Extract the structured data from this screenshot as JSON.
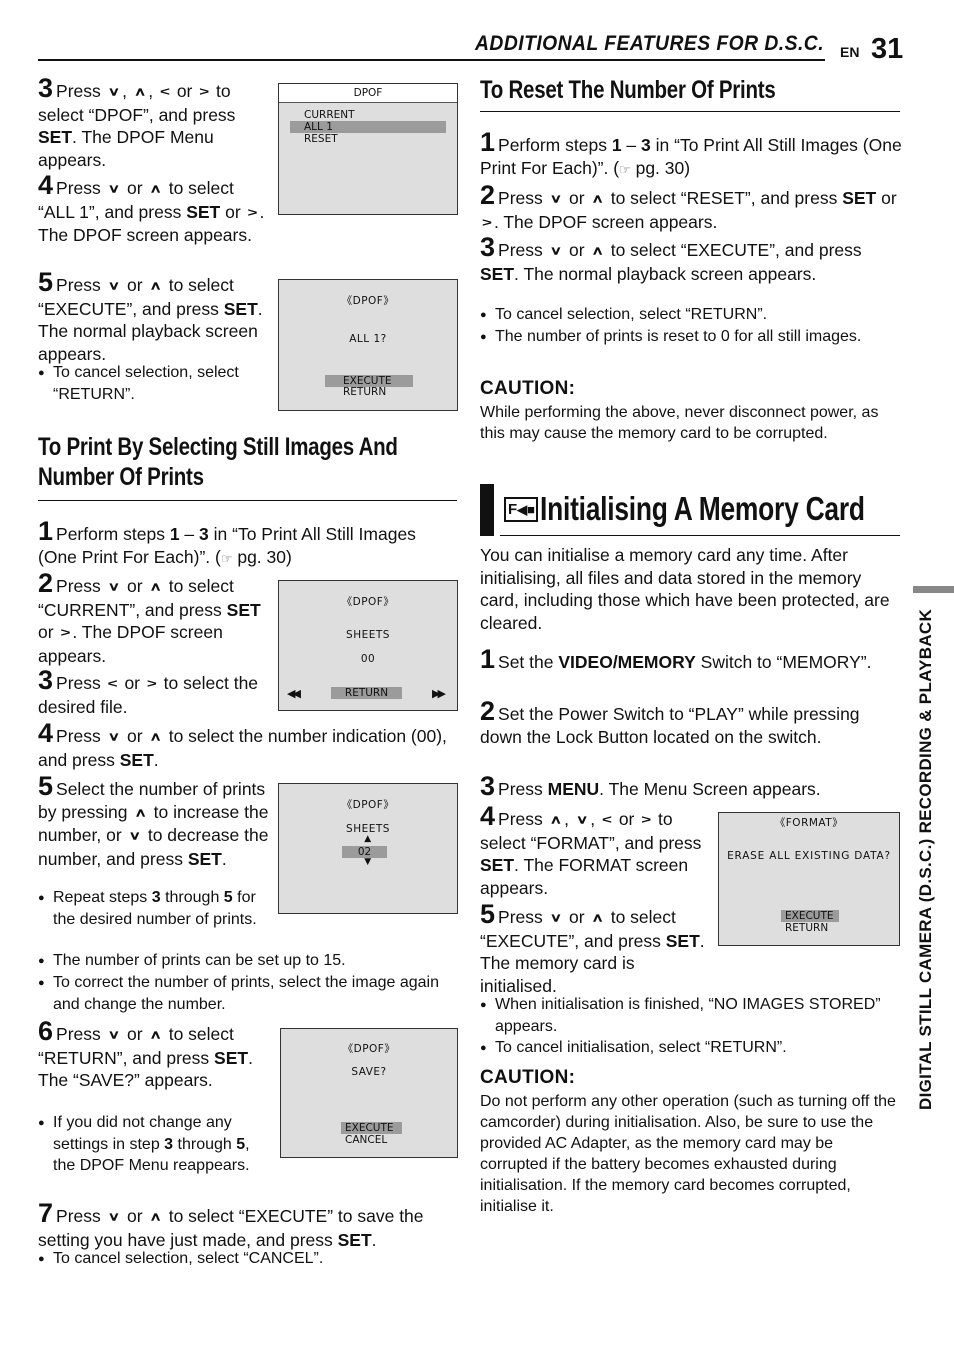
{
  "header": {
    "section_title": "ADDITIONAL FEATURES FOR D.S.C.",
    "lang": "EN",
    "page_number": "31"
  },
  "side_label": "DIGITAL STILL CAMERA (D.S.C.) RECORDING & PLAYBACK",
  "icons": {
    "down": "∨",
    "up": "∧",
    "left": "<",
    "right": ">",
    "ref": "☞"
  },
  "left_top": {
    "step3": {
      "num": "3",
      "parts": [
        "Press ",
        "{down}",
        ", ",
        "{up}",
        ", ",
        "{left}",
        " or ",
        "{right}",
        " to select “DPOF”, and press ",
        "**SET",
        ". The DPOF Menu appears."
      ]
    },
    "step4": {
      "num": "4",
      "parts": [
        "Press ",
        "{down}",
        " or ",
        "{up}",
        " to select “ALL 1”, and press ",
        "**SET",
        " or ",
        "{right}",
        ". The DPOF screen appears."
      ]
    },
    "step5": {
      "num": "5",
      "parts": [
        "Press ",
        "{down}",
        " or ",
        "{up}",
        " to select “EXECUTE”, and press ",
        "**SET",
        ". The normal playback screen appears."
      ]
    },
    "bullet": "To cancel selection, select “RETURN”."
  },
  "screens": {
    "dpof_menu": {
      "title": "DPOF",
      "items": [
        "CURRENT",
        "ALL 1",
        "RESET"
      ],
      "selected": "ALL 1"
    },
    "dpof_all": {
      "title": "《DPOF》",
      "prompt": "ALL 1?",
      "options": [
        "EXECUTE",
        "RETURN"
      ],
      "selected": "EXECUTE"
    },
    "dpof_sheets_00": {
      "title": "《DPOF》",
      "label": "SHEETS",
      "value": "00",
      "button": "RETURN",
      "prev": "◀◀",
      "next": "▶▶"
    },
    "dpof_sheets_02": {
      "title": "《DPOF》",
      "label": "SHEETS",
      "value": "02",
      "up": "▲",
      "down": "▼"
    },
    "dpof_save": {
      "title": "《DPOF》",
      "prompt": "SAVE?",
      "options": [
        "EXECUTE",
        "CANCEL"
      ],
      "selected": "EXECUTE"
    },
    "format": {
      "title": "《FORMAT》",
      "prompt": "ERASE ALL EXISTING DATA?",
      "options": [
        "EXECUTE",
        "RETURN"
      ],
      "selected": "EXECUTE"
    }
  },
  "print_select": {
    "heading": "To Print By Selecting Still Images And Number Of Prints",
    "step1": {
      "num": "1",
      "parts": [
        "Perform steps ",
        "**1",
        " – ",
        "**3",
        " in “To Print All Still Images (One Print For Each)”. (",
        "{ref}",
        " pg. 30)"
      ]
    },
    "step2": {
      "num": "2",
      "parts": [
        "Press ",
        "{down}",
        " or ",
        "{up}",
        " to select “CURRENT”, and press ",
        "**SET",
        " or ",
        "{right}",
        ". The DPOF screen appears."
      ]
    },
    "step3": {
      "num": "3",
      "parts": [
        "Press ",
        "{left}",
        " or ",
        "{right}",
        " to select the desired file."
      ]
    },
    "step4": {
      "num": "4",
      "parts": [
        "Press ",
        "{down}",
        " or ",
        "{up}",
        " to select the number indication (00), and press ",
        "**SET",
        "."
      ]
    },
    "step5": {
      "num": "5",
      "parts": [
        "Select the number of prints by pressing ",
        "{up}",
        " to increase the number, or ",
        "{down}",
        " to decrease the number, and press ",
        "**SET",
        "."
      ]
    },
    "step5_bullets": [
      [
        "Repeat steps ",
        "**3",
        " through ",
        "**5",
        " for the desired number of prints."
      ],
      [
        "The number of prints can be set up to 15."
      ],
      [
        "To correct the number of prints, select the image again and change the number."
      ]
    ],
    "step6": {
      "num": "6",
      "parts": [
        "Press ",
        "{down}",
        " or ",
        "{up}",
        " to select “RETURN”, and press ",
        "**SET",
        ". The “SAVE?” appears."
      ]
    },
    "step6_bullets": [
      [
        "If you did not change any settings in step ",
        "**3",
        " through ",
        "**5",
        ", the DPOF Menu reappears."
      ]
    ],
    "step7": {
      "num": "7",
      "parts": [
        "Press ",
        "{down}",
        " or ",
        "{up}",
        " to select “EXECUTE” to save the setting you have just made, and press ",
        "**SET",
        "."
      ]
    },
    "step7_bullets": [
      [
        "To cancel selection, select “CANCEL”."
      ]
    ]
  },
  "reset": {
    "heading": "To Reset The Number Of Prints",
    "step1": {
      "num": "1",
      "parts": [
        "Perform steps ",
        "**1",
        " – ",
        "**3",
        " in “To Print All Still Images (One Print For Each)”. (",
        "{ref}",
        " pg. 30)"
      ]
    },
    "step2": {
      "num": "2",
      "parts": [
        "Press ",
        "{down}",
        " or ",
        "{up}",
        " to select “RESET”, and press ",
        "**SET",
        " or ",
        "{right}",
        ". The DPOF screen appears."
      ]
    },
    "step3": {
      "num": "3",
      "parts": [
        "Press ",
        "{down}",
        " or ",
        "{up}",
        " to select “EXECUTE”, and press ",
        "**SET",
        ". The normal playback screen appears."
      ]
    },
    "bullets": [
      [
        "To cancel selection, select “RETURN”."
      ],
      [
        "The number of prints is reset to 0 for all still images."
      ]
    ],
    "caution_label": "CAUTION:",
    "caution_text": "While performing the above, never disconnect power, as this may cause the memory card to be corrupted."
  },
  "init": {
    "icon_letter": "F",
    "heading": "Initialising A Memory Card",
    "intro": "You can initialise a memory card any time. After initialising, all files and data stored in the memory card, including those which have been protected, are cleared.",
    "step1": {
      "num": "1",
      "parts": [
        "Set the ",
        "**VIDEO/MEMORY",
        " Switch to “MEMORY”."
      ]
    },
    "step2": {
      "num": "2",
      "parts": [
        "Set the Power Switch to “PLAY” while pressing down the Lock Button located on the switch."
      ]
    },
    "step3": {
      "num": "3",
      "parts": [
        "Press ",
        "**MENU",
        ". The Menu Screen appears."
      ]
    },
    "step4": {
      "num": "4",
      "parts": [
        "Press ",
        "{up}",
        ", ",
        "{down}",
        ", ",
        "{left}",
        " or ",
        "{right}",
        " to select “FORMAT”, and press ",
        "**SET",
        ". The FORMAT screen appears."
      ]
    },
    "step5": {
      "num": "5",
      "parts": [
        "Press ",
        "{down}",
        " or ",
        "{up}",
        " to select “EXECUTE”, and press ",
        "**SET",
        ". The memory card is initialised."
      ]
    },
    "bullets": [
      [
        "When initialisation is finished, “NO IMAGES STORED” appears."
      ],
      [
        "To cancel initialisation, select “RETURN”."
      ]
    ],
    "caution_label": "CAUTION:",
    "caution_text": "Do not perform any other operation (such as turning off the camcorder) during initialisation. Also, be sure to use the provided AC Adapter, as the memory card may be corrupted if the battery becomes exhausted during initialisation. If the memory card becomes corrupted, initialise it."
  }
}
